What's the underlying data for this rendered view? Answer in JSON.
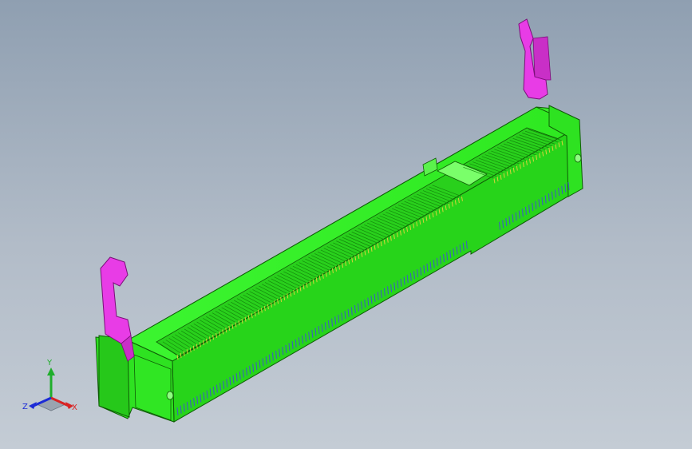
{
  "scene": {
    "background_top": "#8f9fb1",
    "background_bottom": "#c4ccd5"
  },
  "model": {
    "body_color": "#2ff020",
    "latch_color": "#e83ce6",
    "contact_color": "#d6d23c",
    "pin_color": "#3f58c8",
    "edge_color": "#0f5a06"
  },
  "triad": {
    "x_label": "X",
    "y_label": "Y",
    "z_label": "Z",
    "x_color": "#d82424",
    "y_color": "#1fae2b",
    "z_color": "#1c2bd6"
  }
}
